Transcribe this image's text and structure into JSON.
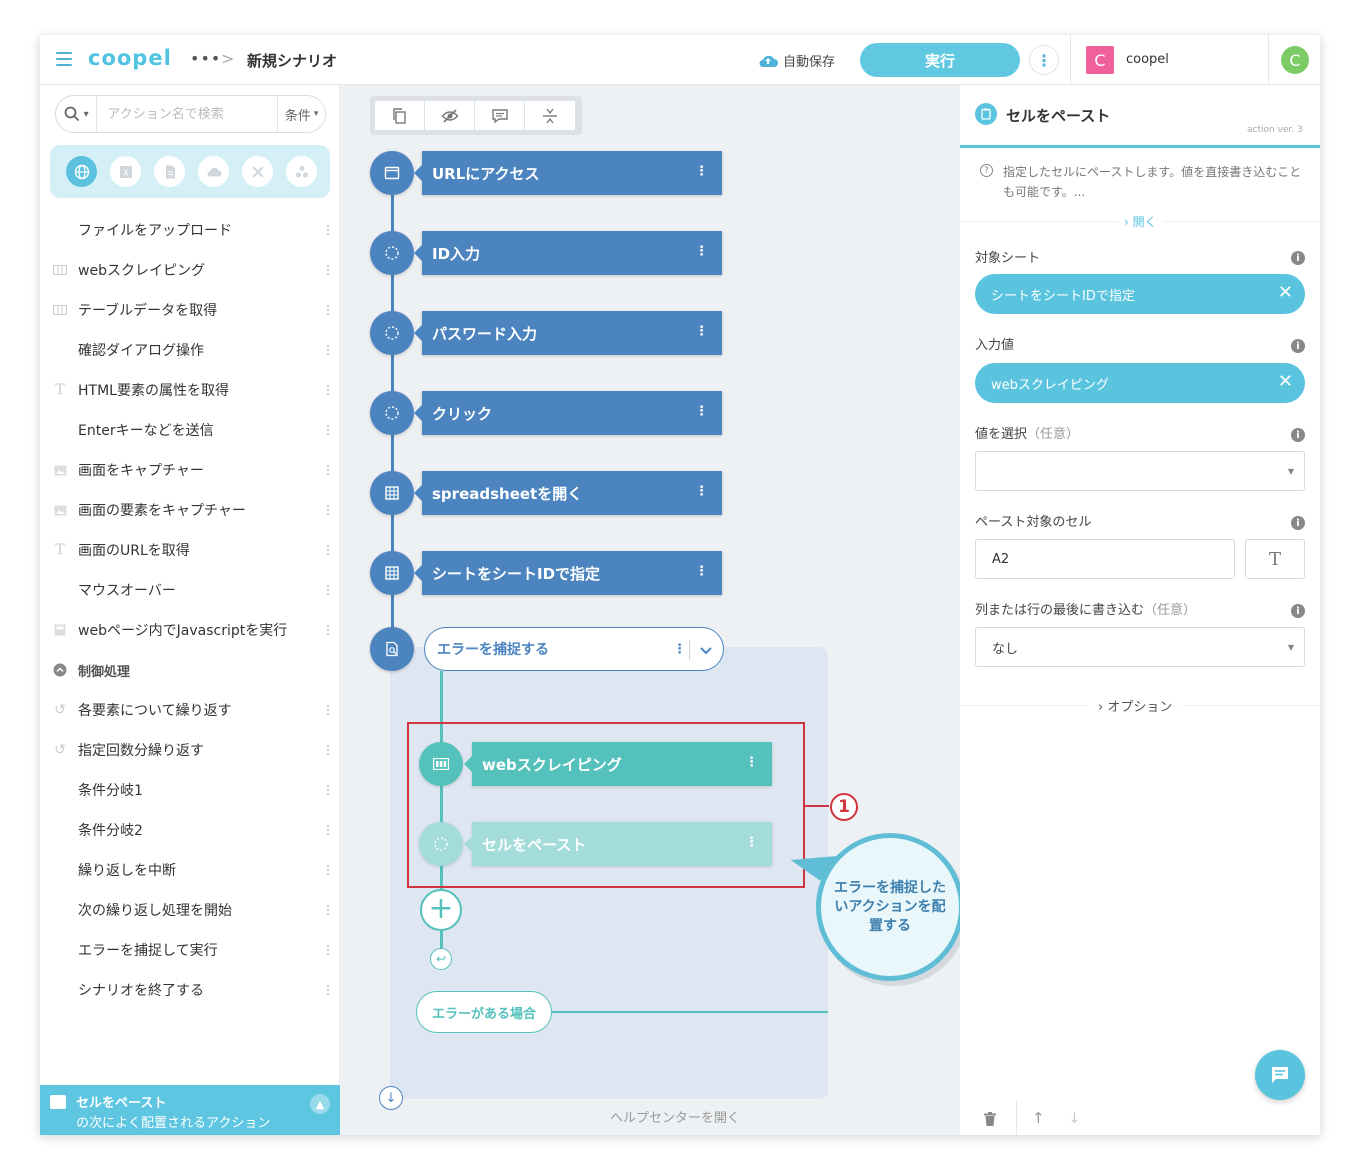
{
  "header": {
    "logo": "coopel",
    "more": "•••",
    "separator": ">",
    "scenario_title": "新規シナリオ",
    "autosave": "自動保存",
    "run": "実行",
    "kebab": "⋮",
    "workspace_initial": "C",
    "workspace_name": "coopel",
    "user_initial": "C"
  },
  "sidebar": {
    "search_placeholder": "アクション名で検索",
    "condition_label": "条件",
    "categories": [
      "web-icon",
      "excel-icon",
      "document-icon",
      "cloud-icon",
      "tools-icon",
      "more-apps-icon"
    ],
    "items": [
      {
        "label": "ファイルをアップロード",
        "icon": ""
      },
      {
        "label": "webスクレイピング",
        "icon": "table-icon"
      },
      {
        "label": "テーブルデータを取得",
        "icon": "table-icon"
      },
      {
        "label": "確認ダイアログ操作",
        "icon": ""
      },
      {
        "label": "HTML要素の属性を取得",
        "icon": "text-icon"
      },
      {
        "label": "Enterキーなどを送信",
        "icon": ""
      },
      {
        "label": "画面をキャプチャー",
        "icon": "image-icon"
      },
      {
        "label": "画面の要素をキャプチャー",
        "icon": "image-icon"
      },
      {
        "label": "画面のURLを取得",
        "icon": "text-icon"
      },
      {
        "label": "マウスオーバー",
        "icon": ""
      },
      {
        "label": "webページ内でJavascriptを実行",
        "icon": "script-icon"
      },
      {
        "label": "制御処理",
        "icon": "collapse-icon"
      },
      {
        "label": "各要素について繰り返す",
        "icon": "loop-icon"
      },
      {
        "label": "指定回数分繰り返す",
        "icon": "loop-icon"
      },
      {
        "label": "条件分岐1",
        "icon": ""
      },
      {
        "label": "条件分岐2",
        "icon": ""
      },
      {
        "label": "繰り返しを中断",
        "icon": ""
      },
      {
        "label": "次の繰り返し処理を開始",
        "icon": ""
      },
      {
        "label": "エラーを捕捉して実行",
        "icon": ""
      },
      {
        "label": "シナリオを終了する",
        "icon": ""
      }
    ],
    "dots": "⋮",
    "hint_title": "セルをペースト",
    "hint_sub": "の次によく配置されるアクション"
  },
  "canvas": {
    "nodes": [
      {
        "label": "URLにアクセス",
        "icon": "browser-icon"
      },
      {
        "label": "ID入力",
        "icon": "dotted-circle-icon"
      },
      {
        "label": "パスワード入力",
        "icon": "dotted-circle-icon"
      },
      {
        "label": "クリック",
        "icon": "dotted-circle-icon"
      },
      {
        "label": "spreadsheetを開く",
        "icon": "grid-icon"
      },
      {
        "label": "シートをシートIDで指定",
        "icon": "grid-icon"
      }
    ],
    "try_label": "エラーを捕捉する",
    "inner_nodes": [
      {
        "label": "webスクレイピング",
        "icon": "table-icon"
      },
      {
        "label": "セルをペースト",
        "icon": "dotted-circle-icon"
      }
    ],
    "add": "+",
    "return": "↩",
    "error_branch": "エラーがある場合",
    "down": "↓",
    "help": "ヘルプセンターを開く",
    "annotation_number": "1",
    "callout": "エラーを捕捉したいアクションを配置する"
  },
  "panel": {
    "title": "セルをペースト",
    "version": "action ver. 3",
    "description": "指定したセルにペーストします。値を直接書き込むことも可能です。...",
    "open": "開く",
    "fields": {
      "sheet_label": "対象シート",
      "sheet_value": "シートをシートIDで指定",
      "input_label": "入力値",
      "input_value": "webスクレイピング",
      "select_label": "値を選択",
      "select_opt": "（任意）",
      "select_value": "",
      "cell_label": "ペースト対象のセル",
      "cell_value": "A2",
      "append_label": "列または行の最後に書き込む",
      "append_opt": "（任意）",
      "append_value": "なし"
    },
    "t_button": "T",
    "clear": "✕",
    "info": "i",
    "options": "オプション",
    "up": "↑",
    "down": "↓"
  }
}
